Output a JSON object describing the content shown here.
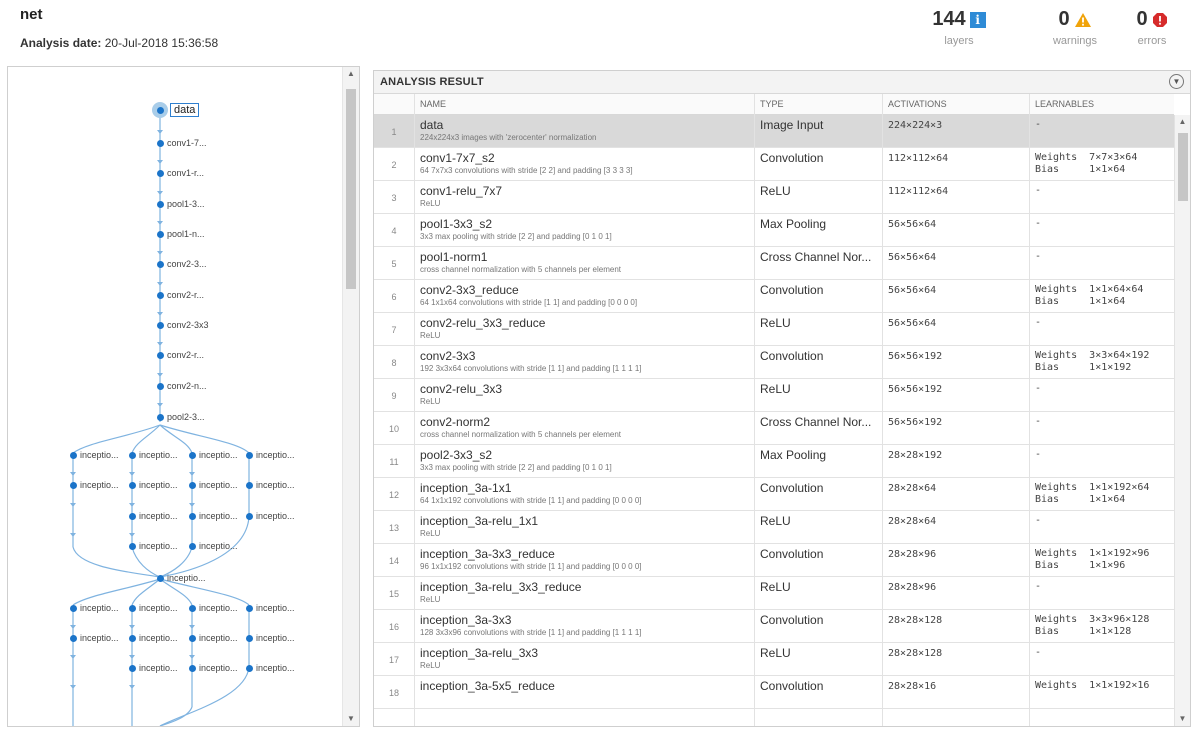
{
  "header": {
    "title": "net",
    "analysis_date_label": "Analysis date:",
    "analysis_date": "20-Jul-2018 15:36:58"
  },
  "stats": [
    {
      "value": "144",
      "label": "layers",
      "icon": "info-icon"
    },
    {
      "value": "0",
      "label": "warnings",
      "icon": "warning-icon"
    },
    {
      "value": "0",
      "label": "errors",
      "icon": "error-icon"
    }
  ],
  "colors": {
    "accent": "#1b74c9",
    "info": "#2e8bd6",
    "warning": "#f0a30a",
    "error": "#d62b2b",
    "selected_row": "#d9d9d9"
  },
  "graph": {
    "nodes": [
      {
        "label": "data",
        "selected": true
      },
      {
        "label": "conv1-7..."
      },
      {
        "label": "conv1-r..."
      },
      {
        "label": "pool1-3..."
      },
      {
        "label": "pool1-n..."
      },
      {
        "label": "conv2-3..."
      },
      {
        "label": "conv2-r..."
      },
      {
        "label": "conv2-3x3"
      },
      {
        "label": "conv2-r..."
      },
      {
        "label": "conv2-n..."
      },
      {
        "label": "pool2-3..."
      },
      {
        "label": "inceptio..."
      },
      {
        "label": "inceptio..."
      },
      {
        "label": "inceptio..."
      },
      {
        "label": "inceptio..."
      },
      {
        "label": "inceptio..."
      },
      {
        "label": "inceptio..."
      },
      {
        "label": "inceptio..."
      },
      {
        "label": "inceptio..."
      },
      {
        "label": "inceptio..."
      },
      {
        "label": "inceptio..."
      },
      {
        "label": "inceptio..."
      },
      {
        "label": "inceptio..."
      },
      {
        "label": "inceptio..."
      },
      {
        "label": "inceptio..."
      },
      {
        "label": "inceptio..."
      },
      {
        "label": "inceptio..."
      },
      {
        "label": "inceptio..."
      },
      {
        "label": "inceptio..."
      },
      {
        "label": "inceptio..."
      },
      {
        "label": "inceptio..."
      },
      {
        "label": "inceptio..."
      },
      {
        "label": "inceptio..."
      },
      {
        "label": "inceptio..."
      },
      {
        "label": "inceptio..."
      },
      {
        "label": "inceptio..."
      }
    ]
  },
  "result": {
    "title": "ANALYSIS RESULT",
    "columns": {
      "name": "NAME",
      "type": "TYPE",
      "activations": "ACTIVATIONS",
      "learnables": "LEARNABLES"
    },
    "rows": [
      {
        "idx": "1",
        "name": "data",
        "desc": "224x224x3 images with 'zerocenter' normalization",
        "type": "Image Input",
        "act": "224×224×3",
        "learn": "-",
        "selected": true
      },
      {
        "idx": "2",
        "name": "conv1-7x7_s2",
        "desc": "64 7x7x3 convolutions with stride [2 2] and padding [3 3 3 3]",
        "type": "Convolution",
        "act": "112×112×64",
        "learn": "Weights  7×7×3×64\nBias     1×1×64"
      },
      {
        "idx": "3",
        "name": "conv1-relu_7x7",
        "desc": "ReLU",
        "type": "ReLU",
        "act": "112×112×64",
        "learn": "-"
      },
      {
        "idx": "4",
        "name": "pool1-3x3_s2",
        "desc": "3x3 max pooling with stride [2 2] and padding [0 1 0 1]",
        "type": "Max Pooling",
        "act": "56×56×64",
        "learn": "-"
      },
      {
        "idx": "5",
        "name": "pool1-norm1",
        "desc": "cross channel normalization with 5 channels per element",
        "type": "Cross Channel Nor...",
        "act": "56×56×64",
        "learn": "-"
      },
      {
        "idx": "6",
        "name": "conv2-3x3_reduce",
        "desc": "64 1x1x64 convolutions with stride [1 1] and padding [0 0 0 0]",
        "type": "Convolution",
        "act": "56×56×64",
        "learn": "Weights  1×1×64×64\nBias     1×1×64"
      },
      {
        "idx": "7",
        "name": "conv2-relu_3x3_reduce",
        "desc": "ReLU",
        "type": "ReLU",
        "act": "56×56×64",
        "learn": "-"
      },
      {
        "idx": "8",
        "name": "conv2-3x3",
        "desc": "192 3x3x64 convolutions with stride [1 1] and padding [1 1 1 1]",
        "type": "Convolution",
        "act": "56×56×192",
        "learn": "Weights  3×3×64×192\nBias     1×1×192"
      },
      {
        "idx": "9",
        "name": "conv2-relu_3x3",
        "desc": "ReLU",
        "type": "ReLU",
        "act": "56×56×192",
        "learn": "-"
      },
      {
        "idx": "10",
        "name": "conv2-norm2",
        "desc": "cross channel normalization with 5 channels per element",
        "type": "Cross Channel Nor...",
        "act": "56×56×192",
        "learn": "-"
      },
      {
        "idx": "11",
        "name": "pool2-3x3_s2",
        "desc": "3x3 max pooling with stride [2 2] and padding [0 1 0 1]",
        "type": "Max Pooling",
        "act": "28×28×192",
        "learn": "-"
      },
      {
        "idx": "12",
        "name": "inception_3a-1x1",
        "desc": "64 1x1x192 convolutions with stride [1 1] and padding [0 0 0 0]",
        "type": "Convolution",
        "act": "28×28×64",
        "learn": "Weights  1×1×192×64\nBias     1×1×64"
      },
      {
        "idx": "13",
        "name": "inception_3a-relu_1x1",
        "desc": "ReLU",
        "type": "ReLU",
        "act": "28×28×64",
        "learn": "-"
      },
      {
        "idx": "14",
        "name": "inception_3a-3x3_reduce",
        "desc": "96 1x1x192 convolutions with stride [1 1] and padding [0 0 0 0]",
        "type": "Convolution",
        "act": "28×28×96",
        "learn": "Weights  1×1×192×96\nBias     1×1×96"
      },
      {
        "idx": "15",
        "name": "inception_3a-relu_3x3_reduce",
        "desc": "ReLU",
        "type": "ReLU",
        "act": "28×28×96",
        "learn": "-"
      },
      {
        "idx": "16",
        "name": "inception_3a-3x3",
        "desc": "128 3x3x96 convolutions with stride [1 1] and padding [1 1 1 1]",
        "type": "Convolution",
        "act": "28×28×128",
        "learn": "Weights  3×3×96×128\nBias     1×1×128"
      },
      {
        "idx": "17",
        "name": "inception_3a-relu_3x3",
        "desc": "ReLU",
        "type": "ReLU",
        "act": "28×28×128",
        "learn": "-"
      },
      {
        "idx": "18",
        "name": "inception_3a-5x5_reduce",
        "desc": "",
        "type": "Convolution",
        "act": "28×28×16",
        "learn": "Weights  1×1×192×16"
      }
    ]
  }
}
